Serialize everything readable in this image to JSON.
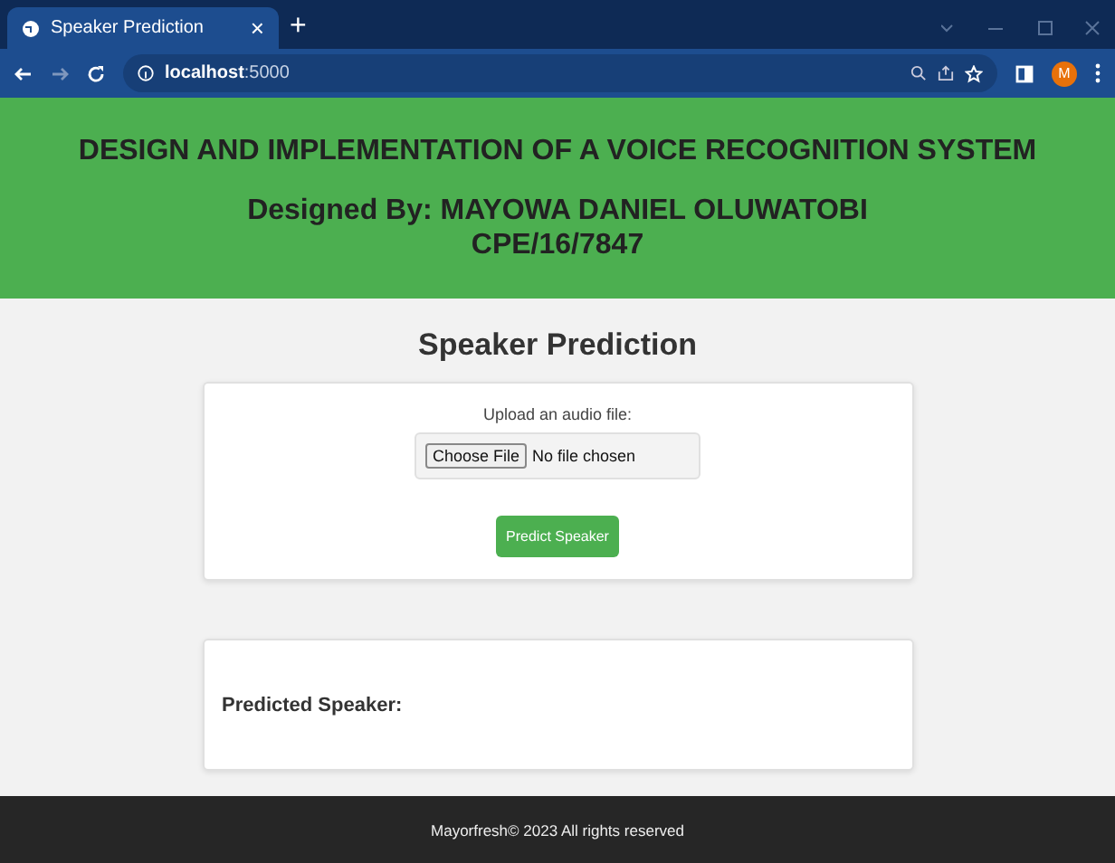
{
  "browser": {
    "tab": {
      "title": "Speaker Prediction",
      "close": "×",
      "selected": true
    },
    "new_tab": "+",
    "address": "**localhost**:5000",
    "avatar": "M"
  },
  "header": {
    "title": "DESIGN AND IMPLEMENTATION OF A VOICE RECOGNITION SYSTEM",
    "byline": "Designed By: MAYOWA DANIEL OLUWATOBI",
    "matric": "CPE/16/7847"
  },
  "main": {
    "heading": "Speaker Prediction",
    "upload_label": "Upload an audio file:",
    "file_button": "Choose File",
    "file_status": "No file chosen",
    "submit": "Predict Speaker"
  },
  "result": {
    "label": "Predicted Speaker:"
  },
  "footer": "Mayorfresh© 2023 All rights reserved"
}
